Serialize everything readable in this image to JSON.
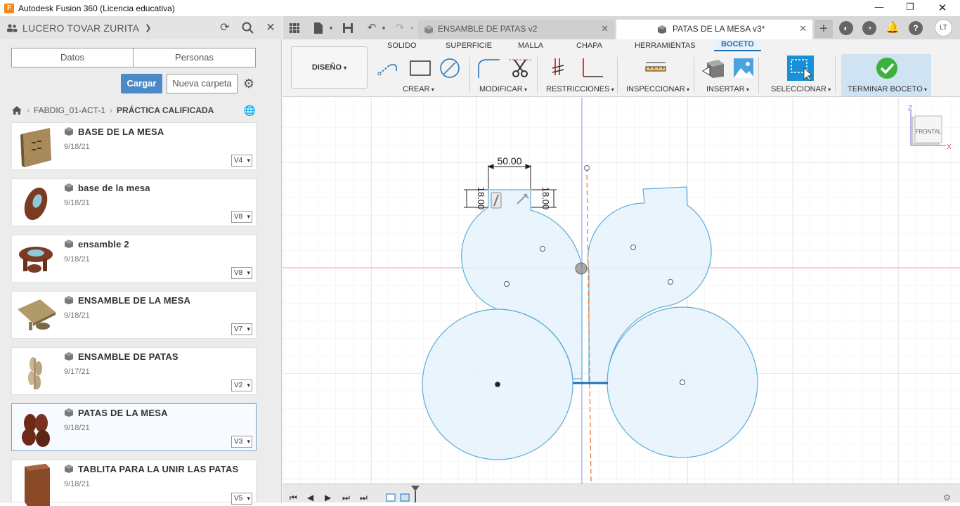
{
  "window": {
    "title": "Autodesk Fusion 360 (Licencia educativa)",
    "app_icon_letter": "F"
  },
  "data_panel": {
    "user_name": "LUCERO TOVAR ZURITA",
    "segments": [
      "Datos",
      "Personas"
    ],
    "upload_label": "Cargar",
    "new_folder_label": "Nueva carpeta",
    "breadcrumb": [
      "FABDIG_01-ACT-1",
      "PRÁCTICA CALIFICADA"
    ],
    "files": [
      {
        "name": "BASE DE LA MESA",
        "date": "9/18/21",
        "version": "V4",
        "thumb": "plank"
      },
      {
        "name": "base de la mesa",
        "date": "9/18/21",
        "version": "V8",
        "thumb": "disc"
      },
      {
        "name": "ensamble 2",
        "date": "9/18/21",
        "version": "V8",
        "thumb": "table-round"
      },
      {
        "name": "ENSAMBLE DE LA MESA",
        "date": "9/18/21",
        "version": "V7",
        "thumb": "table-square"
      },
      {
        "name": "ENSAMBLE DE PATAS",
        "date": "9/17/21",
        "version": "V2",
        "thumb": "legs-light"
      },
      {
        "name": "PATAS DE LA MESA",
        "date": "9/18/21",
        "version": "V3",
        "thumb": "legs-dark",
        "selected": true
      },
      {
        "name": "TABLITA PARA LA UNIR LAS PATAS",
        "date": "9/18/21",
        "version": "V5",
        "thumb": "block"
      }
    ]
  },
  "tabs": [
    {
      "label": "ENSAMBLE DE PATAS v2",
      "active": false
    },
    {
      "label": "PATAS DE LA MESA v3*",
      "active": true
    }
  ],
  "user_initials": "LT",
  "toolbar": {
    "design_label": "DISEÑO",
    "workspace_tabs": [
      "SOLIDO",
      "SUPERFICIE",
      "MALLA",
      "CHAPA",
      "HERRAMIENTAS",
      "BOCETO"
    ],
    "active_workspace": "BOCETO",
    "groups": [
      "CREAR",
      "MODIFICAR",
      "RESTRICCIONES",
      "INSPECCIONAR",
      "INSERTAR",
      "SELECCIONAR",
      "TERMINAR BOCETO"
    ]
  },
  "canvas": {
    "dimension_width": "50.00",
    "dimension_left": "18.00",
    "dimension_right": "18.00",
    "viewcube_label": "FRONTAL",
    "axis_z": "Z",
    "axis_x": "X"
  },
  "colors": {
    "accent": "#1c6fb8",
    "sketch_fill": "#e6f2fb",
    "sketch_stroke": "#5aaed8",
    "finish_check": "#3bb33b",
    "grid": "#e2e2e2",
    "axis_red": "#f2a0a0",
    "axis_blue": "#9c9ce6",
    "construction_orange": "#e8803a"
  }
}
